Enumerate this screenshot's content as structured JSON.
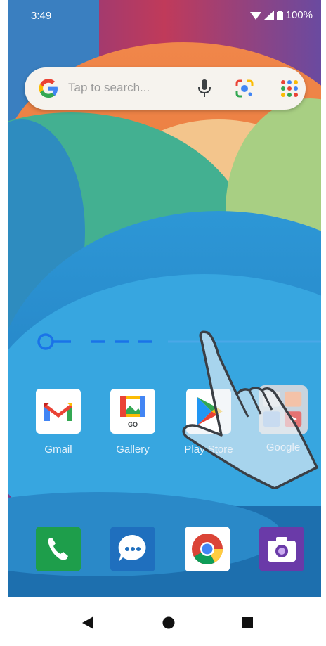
{
  "status_bar": {
    "time": "3:49",
    "battery": "100%"
  },
  "search": {
    "placeholder": "Tap to search..."
  },
  "home_apps": [
    {
      "label": "Gmail",
      "icon": "gmail-icon"
    },
    {
      "label": "Gallery",
      "icon": "gallery-icon",
      "badge": "GO"
    },
    {
      "label": "Play Store",
      "icon": "play-store-icon"
    },
    {
      "label": "Google",
      "icon": "google-folder-icon"
    }
  ],
  "dock_apps": [
    {
      "name": "Phone",
      "icon": "phone-icon"
    },
    {
      "name": "Messages",
      "icon": "messages-icon"
    },
    {
      "name": "Chrome",
      "icon": "chrome-icon"
    },
    {
      "name": "Camera",
      "icon": "camera-icon"
    }
  ],
  "nav": {
    "back": "back-icon",
    "home": "home-icon",
    "recents": "recents-icon"
  },
  "gesture": "swipe-hand-icon",
  "colors": {
    "accent": "#1a73e8",
    "search_bg": "#f6f3ee",
    "wallpaper_blue": "#2a8fcf"
  }
}
